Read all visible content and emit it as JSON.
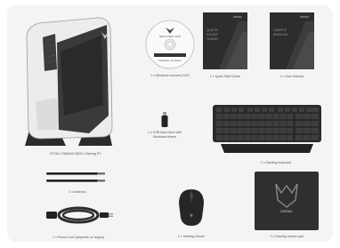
{
  "items": {
    "pc": {
      "caption": "ZOTAC GAMING MEK1 Gaming PC"
    },
    "dvd": {
      "caption": "1 x Windows recovery DVD",
      "disc_lines": [
        "RECOVERY DVD",
        "Windows 10 Home"
      ]
    },
    "quick_start": {
      "caption": "1 x Quick Start Guide",
      "cover_text": [
        "QUICK",
        "START",
        "GUIDE"
      ],
      "brand": "ZOTAC"
    },
    "user_manual": {
      "caption": "1 x User Manual",
      "cover_text": [
        "USER'S",
        "MANUAL"
      ],
      "brand": "ZOTAC"
    },
    "usb": {
      "caption_lines": [
        "1 x USB flash drive with",
        "Windows drivers"
      ]
    },
    "keyboard": {
      "caption": "1 x Gaming keyboard"
    },
    "antenna": {
      "caption": "2 x Antenna"
    },
    "power_cord": {
      "caption": "1 x Power Cord (depends on region)"
    },
    "mouse": {
      "caption": "1 x Gaming mouse"
    },
    "mousepad": {
      "caption": "1 x Gaming mouse pad",
      "logo_text": "ZOTAC"
    }
  }
}
